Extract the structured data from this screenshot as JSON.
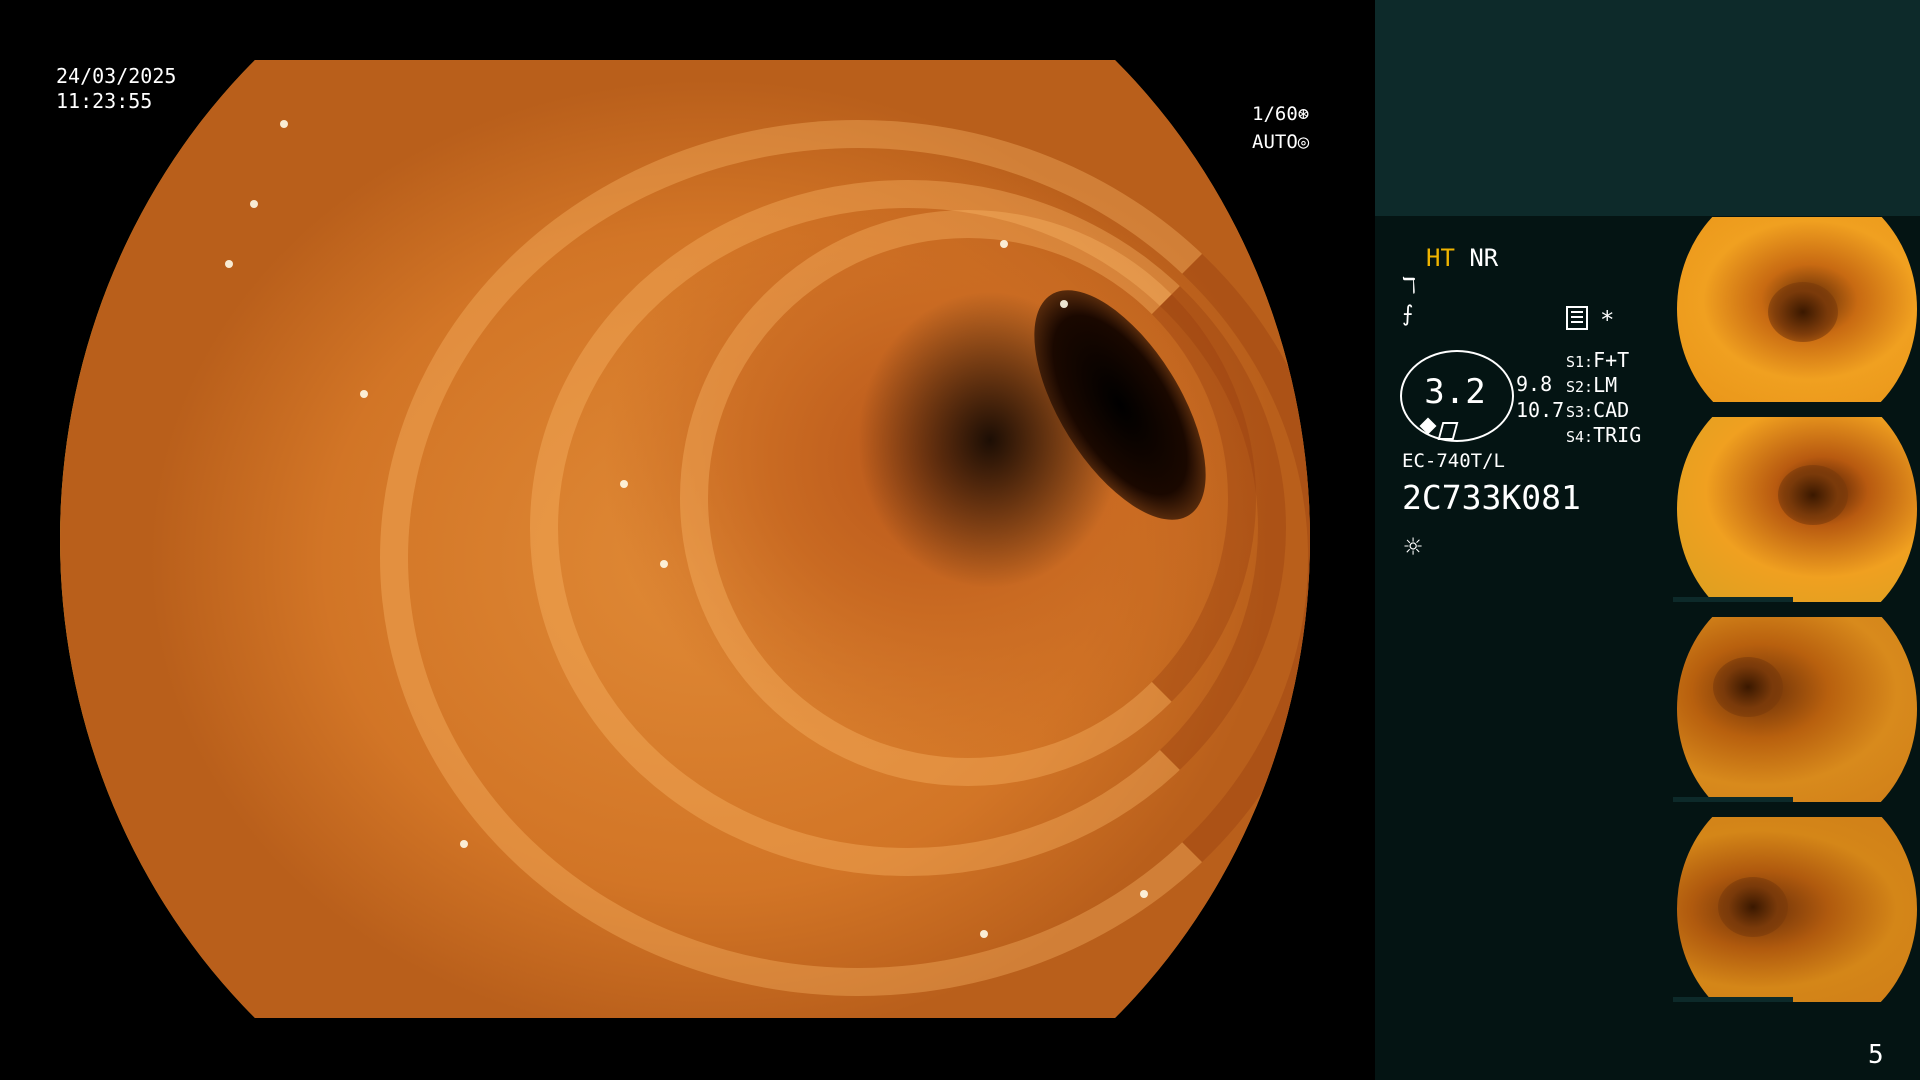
{
  "overlay": {
    "date": "24/03/2025",
    "time": "11:23:55",
    "shutter": "1/60",
    "shutter_icon": "shutter-icon",
    "exposure_mode": "AUTO",
    "exposure_icon": "iris-icon"
  },
  "info": {
    "ht": "HT",
    "nr": "NR",
    "icons": [
      "enhance-icon",
      "contrast-icon",
      "menu-icon",
      "asterisk-icon",
      "light-icon"
    ],
    "asterisk": "*",
    "zoom_value": "3.2",
    "zoom_a": "9.8",
    "zoom_b": "10.7",
    "slots": [
      {
        "key": "S1:",
        "value": "F+T"
      },
      {
        "key": "S2:",
        "value": "LM"
      },
      {
        "key": "S3:",
        "value": "CAD"
      },
      {
        "key": "S4:",
        "value": "TRIG"
      }
    ],
    "model": "EC-740T/L",
    "serial": "2C733K081"
  },
  "thumbnails_count": 4,
  "page_number": "5",
  "colors": {
    "accent_yellow": "#f0b400",
    "panel_top": "#0d2a2a",
    "panel_bottom": "#041413",
    "tissue": "#d27526"
  }
}
